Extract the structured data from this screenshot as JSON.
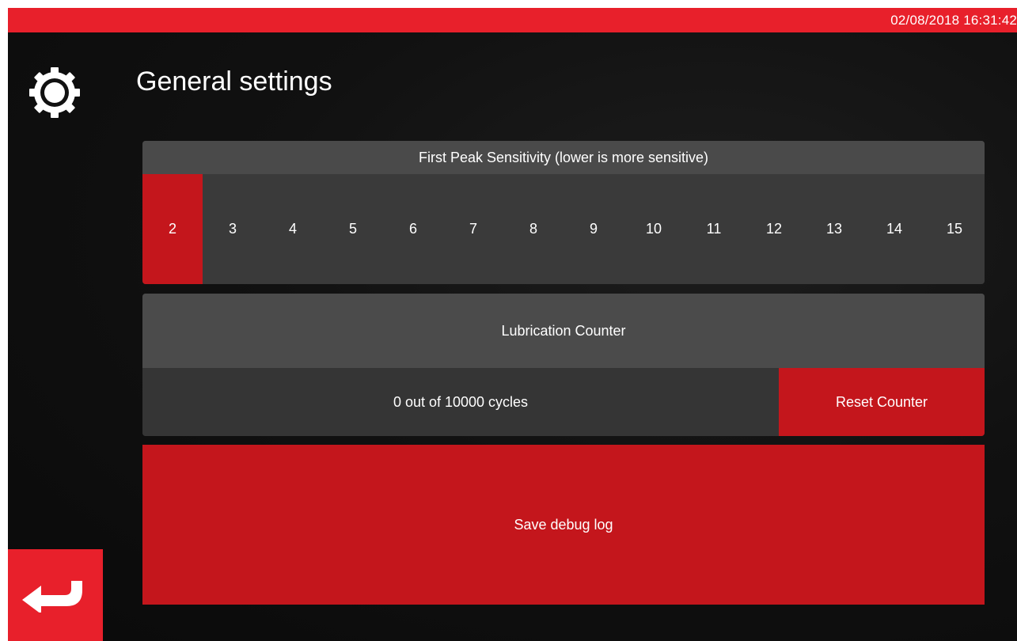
{
  "status_bar": {
    "datetime": "02/08/2018 16:31:42"
  },
  "page": {
    "title": "General settings",
    "icon": "gear-icon"
  },
  "sensitivity": {
    "header": "First Peak Sensitivity (lower is more sensitive)",
    "options": [
      "2",
      "3",
      "4",
      "5",
      "6",
      "7",
      "8",
      "9",
      "10",
      "11",
      "12",
      "13",
      "14",
      "15"
    ],
    "selected": "2"
  },
  "lubrication": {
    "header": "Lubrication Counter",
    "count_text": "0 out of 10000 cycles",
    "reset_label": "Reset Counter"
  },
  "actions": {
    "save_debug_label": "Save debug log"
  },
  "navigation": {
    "back_icon": "back-arrow-icon"
  },
  "colors": {
    "accent": "#e8202b",
    "button_red": "#c4161c"
  }
}
